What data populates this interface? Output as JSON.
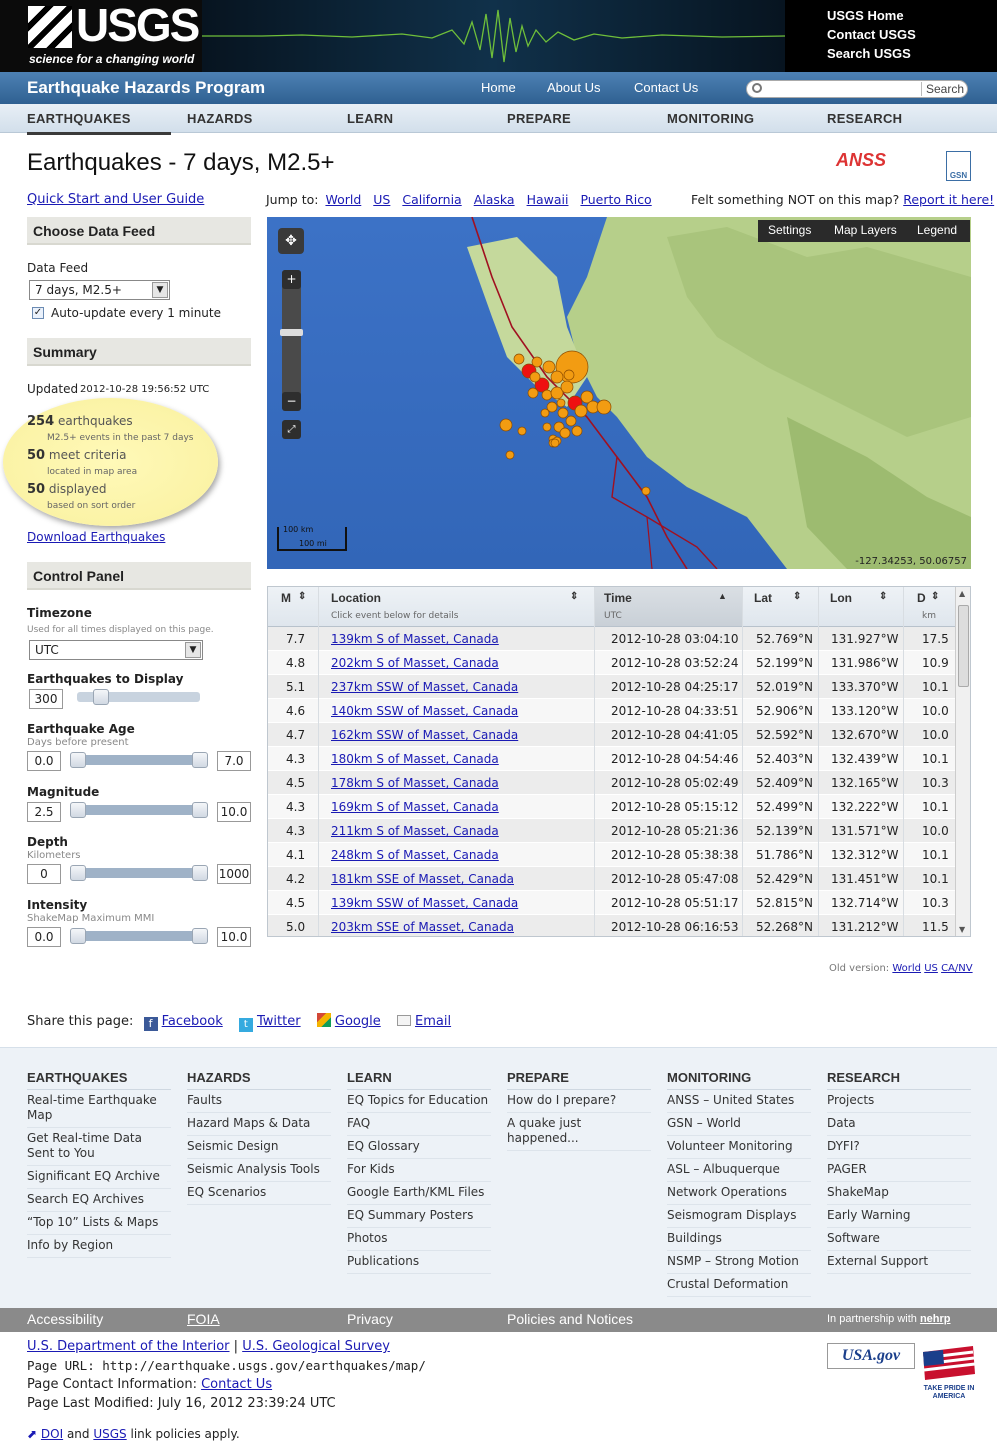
{
  "header": {
    "logo_text": "USGS",
    "tagline": "science for a changing world",
    "links": [
      "USGS Home",
      "Contact USGS",
      "Search USGS"
    ]
  },
  "bar": {
    "program": "Earthquake Hazards Program",
    "nav": [
      "Home",
      "About Us",
      "Contact Us"
    ],
    "search_button": "Search",
    "search_placeholder": ""
  },
  "menu": [
    "EARTHQUAKES",
    "HAZARDS",
    "LEARN",
    "PREPARE",
    "MONITORING",
    "RESEARCH"
  ],
  "page": {
    "title": "Earthquakes - 7 days, M2.5+",
    "anss": "ANSS",
    "gsn": "GSN"
  },
  "sidebar": {
    "quick_start": "Quick Start and User Guide",
    "choose_feed": "Choose Data Feed",
    "data_feed_label": "Data Feed",
    "data_feed_value": "7 days, M2.5+",
    "auto_update": "Auto-update every 1 minute",
    "summary": "Summary",
    "updated_label": "Updated",
    "updated_value": "2012-10-28 19:56:52 UTC",
    "count1": "254",
    "count1_label": "earthquakes",
    "count1_sub": "M2.5+ events in the past 7 days",
    "count2": "50",
    "count2_label": "meet criteria",
    "count2_sub": "located in map area",
    "count3": "50",
    "count3_label": "displayed",
    "count3_sub": "based on sort order",
    "download": "Download Earthquakes",
    "control_panel": "Control Panel",
    "timezone": "Timezone",
    "timezone_sub": "Used for all times displayed on this page.",
    "timezone_value": "UTC",
    "display_label": "Earthquakes to Display",
    "display_value": "300",
    "display_level": 0.0,
    "age_label": "Earthquake Age",
    "age_sub": "Days before present",
    "age_min": "0.0",
    "age_max": "7.0",
    "mag_label": "Magnitude",
    "mag_min": "2.5",
    "mag_max": "10.0",
    "depth_label": "Depth",
    "depth_sub": "Kilometers",
    "depth_min": "0",
    "depth_max": "1000",
    "int_label": "Intensity",
    "int_sub": "ShakeMap Maximum MMI",
    "int_min": "0.0",
    "int_max": "10.0"
  },
  "jump": {
    "label": "Jump to:",
    "links": [
      "World",
      "US",
      "California",
      "Alaska",
      "Hawaii",
      "Puerto Rico"
    ],
    "felt": "Felt something NOT on this map?",
    "report": "Report it here!"
  },
  "map": {
    "toolbar": [
      "Settings",
      "Map Layers",
      "Legend"
    ],
    "scale_km": "100 km",
    "scale_mi": "100 mi",
    "coords": "-127.34253, 50.06757"
  },
  "table": {
    "headers": {
      "m": "M",
      "location": "Location",
      "location_sub": "Click event below for details",
      "time": "Time",
      "time_sub": "UTC",
      "lat": "Lat",
      "lon": "Lon",
      "d": "D",
      "d_sub": "km"
    },
    "rows": [
      [
        "7.7",
        "139km S of Masset, Canada",
        "2012-10-28 03:04:10",
        "52.769°N",
        "131.927°W",
        "17.5"
      ],
      [
        "4.8",
        "202km S of Masset, Canada",
        "2012-10-28 03:52:24",
        "52.199°N",
        "131.986°W",
        "10.9"
      ],
      [
        "5.1",
        "237km SSW of Masset, Canada",
        "2012-10-28 04:25:17",
        "52.019°N",
        "133.370°W",
        "10.1"
      ],
      [
        "4.6",
        "140km SSW of Masset, Canada",
        "2012-10-28 04:33:51",
        "52.906°N",
        "133.120°W",
        "10.0"
      ],
      [
        "4.7",
        "162km SSW of Masset, Canada",
        "2012-10-28 04:41:05",
        "52.592°N",
        "132.670°W",
        "10.0"
      ],
      [
        "4.3",
        "180km S of Masset, Canada",
        "2012-10-28 04:54:46",
        "52.403°N",
        "132.439°W",
        "10.1"
      ],
      [
        "4.5",
        "178km S of Masset, Canada",
        "2012-10-28 05:02:49",
        "52.409°N",
        "132.165°W",
        "10.3"
      ],
      [
        "4.3",
        "169km S of Masset, Canada",
        "2012-10-28 05:15:12",
        "52.499°N",
        "132.222°W",
        "10.1"
      ],
      [
        "4.3",
        "211km S of Masset, Canada",
        "2012-10-28 05:21:36",
        "52.139°N",
        "131.571°W",
        "10.0"
      ],
      [
        "4.1",
        "248km S of Masset, Canada",
        "2012-10-28 05:38:38",
        "51.786°N",
        "132.312°W",
        "10.1"
      ],
      [
        "4.2",
        "181km SSE of Masset, Canada",
        "2012-10-28 05:47:08",
        "52.429°N",
        "131.451°W",
        "10.1"
      ],
      [
        "4.5",
        "139km SSW of Masset, Canada",
        "2012-10-28 05:51:17",
        "52.815°N",
        "132.714°W",
        "10.3"
      ],
      [
        "5.0",
        "203km SSE of Masset, Canada",
        "2012-10-28 06:16:53",
        "52.268°N",
        "131.212°W",
        "11.5"
      ]
    ]
  },
  "oldversion": {
    "label": "Old version:",
    "links": [
      "World",
      "US",
      "CA/NV"
    ]
  },
  "share": {
    "label": "Share this page:",
    "items": [
      "Facebook",
      "Twitter",
      "Google",
      "Email"
    ]
  },
  "footer": {
    "cols": [
      {
        "h": "EARTHQUAKES",
        "items": [
          "Real-time Earthquake Map",
          "Get Real-time Data Sent to You",
          "Significant EQ Archive",
          "Search EQ Archives",
          "“Top 10” Lists & Maps",
          "Info by Region"
        ]
      },
      {
        "h": "HAZARDS",
        "items": [
          "Faults",
          "Hazard Maps & Data",
          "Seismic Design",
          "Seismic Analysis Tools",
          "EQ Scenarios"
        ]
      },
      {
        "h": "LEARN",
        "items": [
          "EQ Topics for Education",
          "FAQ",
          "EQ Glossary",
          "For Kids",
          "Google Earth/KML Files",
          "EQ Summary Posters",
          "Photos",
          "Publications"
        ]
      },
      {
        "h": "PREPARE",
        "items": [
          "How do I prepare?",
          "A quake just happened..."
        ]
      },
      {
        "h": "MONITORING",
        "items": [
          "ANSS – United States",
          "GSN – World",
          "Volunteer Monitoring",
          "ASL – Albuquerque",
          "Network Operations",
          "Seismogram Displays",
          "Buildings",
          "NSMP – Strong Motion",
          "Crustal Deformation"
        ]
      },
      {
        "h": "RESEARCH",
        "items": [
          "Projects",
          "Data",
          "DYFI?",
          "PAGER",
          "ShakeMap",
          "Early Warning",
          "Software",
          "External Support"
        ]
      }
    ],
    "bottom": [
      "Accessibility",
      "FOIA",
      "Privacy",
      "Policies and Notices"
    ],
    "partner": "In partnership with",
    "partner_name": "nehrp",
    "doi": "U.S. Department of the Interior",
    "sep": "|",
    "usgs": "U.S. Geological Survey",
    "url_line": "Page URL: http://earthquake.usgs.gov/earthquakes/map/",
    "contact_label": "Page Contact Information:",
    "contact_link": "Contact Us",
    "modified": "Page Last Modified: July 16, 2012 23:39:24 UTC",
    "policy_doi": "DOI",
    "policy_and": "and",
    "policy_usgs": "USGS",
    "policy_rest": "link policies apply.",
    "usagov": "USA.gov",
    "pride": "TAKE PRIDE IN AMERICA"
  }
}
